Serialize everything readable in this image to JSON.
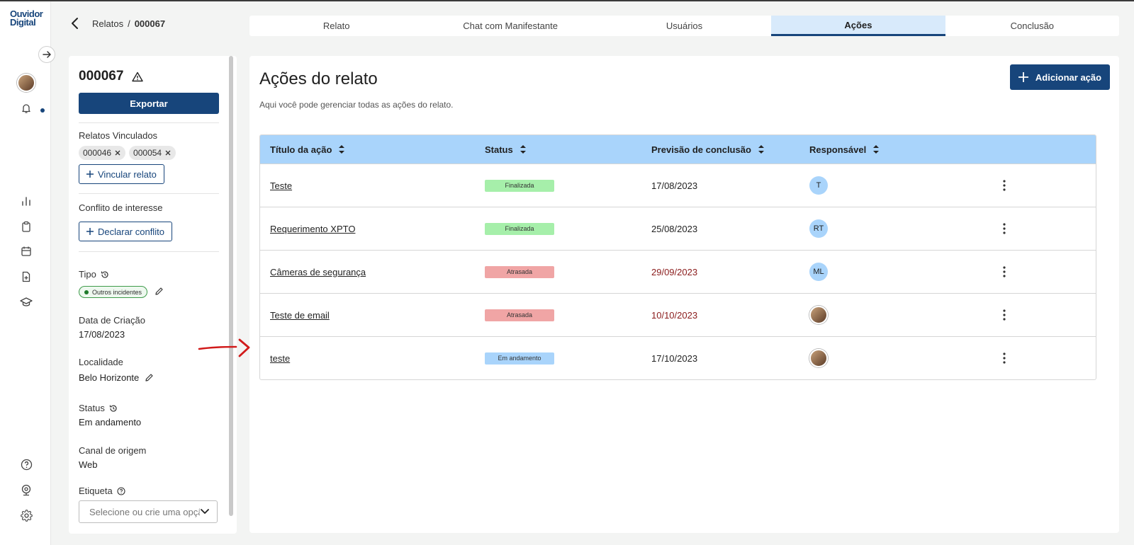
{
  "app": {
    "logo_line1": "Ouvidor",
    "logo_line2": "Digital"
  },
  "icons": {
    "rail": [
      "expand-arrow-icon",
      "avatar",
      "bell-icon",
      "bar-chart-icon",
      "clipboard-icon",
      "calendar-icon",
      "file-plus-icon",
      "graduation-cap-icon",
      "help-circle-icon",
      "webcam-icon",
      "gear-icon"
    ]
  },
  "breadcrumb": {
    "parent": "Relatos",
    "separator": "/",
    "current": "000067"
  },
  "tabs": [
    {
      "label": "Relato"
    },
    {
      "label": "Chat com Manifestante"
    },
    {
      "label": "Usuários"
    },
    {
      "label": "Ações"
    },
    {
      "label": "Conclusão"
    }
  ],
  "side": {
    "report_id": "000067",
    "export_label": "Exportar",
    "linked_label": "Relatos Vinculados",
    "linked": [
      "000046",
      "000054"
    ],
    "link_button": "Vincular relato",
    "conflict_label": "Conflito de interesse",
    "conflict_button": "Declarar conflito",
    "type_label": "Tipo",
    "type_value": "Outros incidentes",
    "created_label": "Data de Criação",
    "created_value": "17/08/2023",
    "locality_label": "Localidade",
    "locality_value": "Belo Horizonte",
    "status_label": "Status",
    "status_value": "Em andamento",
    "channel_label": "Canal de origem",
    "channel_value": "Web",
    "tag_label": "Etiqueta",
    "tag_placeholder": "Selecione ou crie uma opção"
  },
  "main": {
    "title": "Ações do relato",
    "subtitle": "Aqui você pode gerenciar todas as ações do relato.",
    "add_button": "Adicionar ação",
    "columns": [
      "Título da ação",
      "Status",
      "Previsão de conclusão",
      "Responsável"
    ],
    "rows": [
      {
        "title": "Teste",
        "status": "Finalizada",
        "date": "17/08/2023",
        "late": false,
        "responsible": "T",
        "photo": false
      },
      {
        "title": "Requerimento XPTO",
        "status": "Finalizada",
        "date": "25/08/2023",
        "late": false,
        "responsible": "RT",
        "photo": false
      },
      {
        "title": "Câmeras de segurança",
        "status": "Atrasada",
        "date": "29/09/2023",
        "late": true,
        "responsible": "ML",
        "photo": false
      },
      {
        "title": "Teste de email",
        "status": "Atrasada",
        "date": "10/10/2023",
        "late": true,
        "responsible": "",
        "photo": true
      },
      {
        "title": "teste",
        "status": "Em andamento",
        "date": "17/10/2023",
        "late": false,
        "responsible": "",
        "photo": true
      }
    ]
  },
  "colors": {
    "primary": "#17457b",
    "table_header": "#a9d4fb",
    "badge_finalizada": "#a6efaa",
    "badge_atrasada": "#f0a5a5",
    "badge_em_andamento": "#a9d4fb",
    "late_date": "#8a1b1b",
    "annotation_arrow": "#d11a1a"
  }
}
